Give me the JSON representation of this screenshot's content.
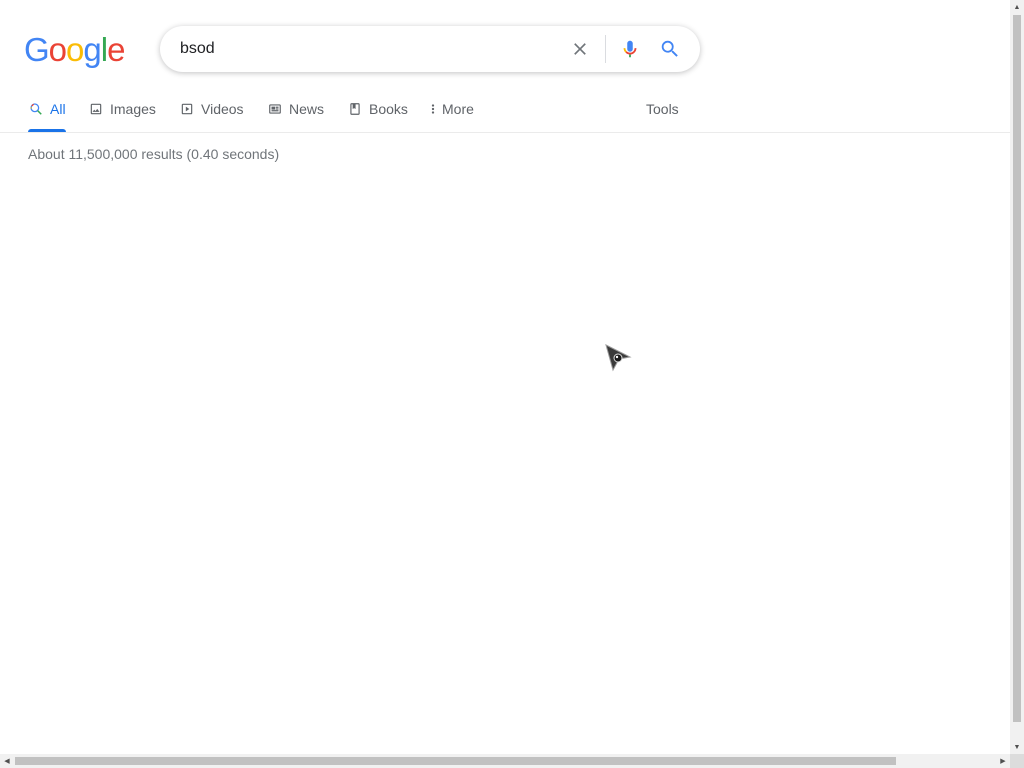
{
  "logo": {
    "letters": [
      {
        "char": "G",
        "color": "#4285F4"
      },
      {
        "char": "o",
        "color": "#EA4335"
      },
      {
        "char": "o",
        "color": "#FBBC05"
      },
      {
        "char": "g",
        "color": "#4285F4"
      },
      {
        "char": "l",
        "color": "#34A853"
      },
      {
        "char": "e",
        "color": "#EA4335"
      }
    ]
  },
  "search": {
    "value": "bsod",
    "clear_icon": "close-icon",
    "mic_icon": "microphone-icon",
    "search_icon": "search-icon"
  },
  "tabs": [
    {
      "label": "All",
      "icon": "search-icon",
      "active": true
    },
    {
      "label": "Images",
      "icon": "image-icon",
      "active": false
    },
    {
      "label": "Videos",
      "icon": "play-icon",
      "active": false
    },
    {
      "label": "News",
      "icon": "newspaper-icon",
      "active": false
    },
    {
      "label": "Books",
      "icon": "book-icon",
      "active": false
    },
    {
      "label": "More",
      "icon": "more-vert-icon",
      "active": false
    }
  ],
  "tools_label": "Tools",
  "result_stats": "About 11,500,000 results (0.40 seconds)",
  "colors": {
    "accent": "#1a73e8",
    "tab_text": "#5f6368",
    "stats_text": "#70757a"
  }
}
